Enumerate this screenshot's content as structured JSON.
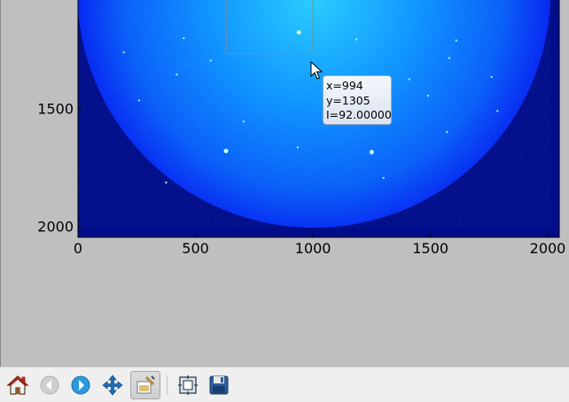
{
  "plot": {
    "colormap": "jet",
    "image_center": [
      1004,
      1000
    ],
    "x_ticks": [
      {
        "value": 0,
        "label": "0"
      },
      {
        "value": 500,
        "label": "500"
      },
      {
        "value": 1000,
        "label": "1000"
      },
      {
        "value": 1500,
        "label": "1500"
      },
      {
        "value": 2000,
        "label": "2000"
      }
    ],
    "y_ticks": [
      {
        "value": 1500,
        "label": "1500"
      },
      {
        "value": 2000,
        "label": "2000"
      }
    ],
    "xlim": [
      0,
      2048
    ],
    "ylim_visible": [
      1000,
      2048
    ],
    "zoom_selection_rect": {
      "x0": 630,
      "x1": 1000,
      "y0": 1030,
      "y1": 1265
    },
    "bragg_spots": [
      {
        "x": 940,
        "y": 1175
      },
      {
        "x": 630,
        "y": 1680
      },
      {
        "x": 1250,
        "y": 1685
      },
      {
        "x": 705,
        "y": 1555
      },
      {
        "x": 1410,
        "y": 1375
      },
      {
        "x": 1580,
        "y": 1285
      },
      {
        "x": 1610,
        "y": 1210
      },
      {
        "x": 1760,
        "y": 1365
      },
      {
        "x": 1570,
        "y": 1600
      },
      {
        "x": 1300,
        "y": 1795
      },
      {
        "x": 565,
        "y": 1295
      },
      {
        "x": 450,
        "y": 1200
      },
      {
        "x": 260,
        "y": 1465
      },
      {
        "x": 195,
        "y": 1260
      },
      {
        "x": 420,
        "y": 1355
      },
      {
        "x": 1185,
        "y": 1205
      },
      {
        "x": 1490,
        "y": 1445
      },
      {
        "x": 375,
        "y": 1815
      },
      {
        "x": 935,
        "y": 1665
      },
      {
        "x": 1785,
        "y": 1510
      }
    ]
  },
  "colors": {
    "background_dark": "#000c8a",
    "disc_center": "#26cbff",
    "disc_mid": "#0a7cff",
    "disc_edge": "#0425f2",
    "figure_bg": "#bfbfbf"
  },
  "tooltip": {
    "x_text": "x=994",
    "y_text": "y=1305",
    "i_text": "I=92.00000"
  },
  "toolbar": {
    "buttons": [
      {
        "name": "home-button",
        "icon": "home-icon"
      },
      {
        "name": "back-button",
        "icon": "back-arrow-icon",
        "state": "disabled"
      },
      {
        "name": "forward-button",
        "icon": "forward-arrow-icon"
      },
      {
        "name": "pan-button",
        "icon": "move-arrows-icon"
      },
      {
        "name": "zoom-button",
        "icon": "zoom-rect-icon",
        "state": "active"
      },
      {
        "name": "configure-subplots-button",
        "icon": "subplots-icon"
      },
      {
        "name": "save-button",
        "icon": "floppy-disk-icon"
      }
    ]
  }
}
